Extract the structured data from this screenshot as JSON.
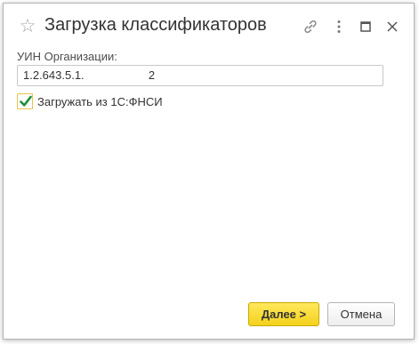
{
  "window": {
    "title": "Загрузка классификаторов",
    "icons": {
      "favorite": "star-icon",
      "link": "link-icon",
      "menu": "more-vertical-icon",
      "maximize": "maximize-icon",
      "close": "close-icon"
    }
  },
  "form": {
    "org_uin_label": "УИН Организации:",
    "org_uin_value": "1.2.643.5.1.                    2",
    "load_from_fnsi_label": "Загружать из 1С:ФНСИ",
    "load_from_fnsi_checked": true
  },
  "buttons": {
    "next_label": "Далее >",
    "cancel_label": "Отмена"
  },
  "colors": {
    "accent_yellow": "#f4d11c",
    "checkmark_green": "#1e8f3a",
    "title_text": "#333333"
  }
}
